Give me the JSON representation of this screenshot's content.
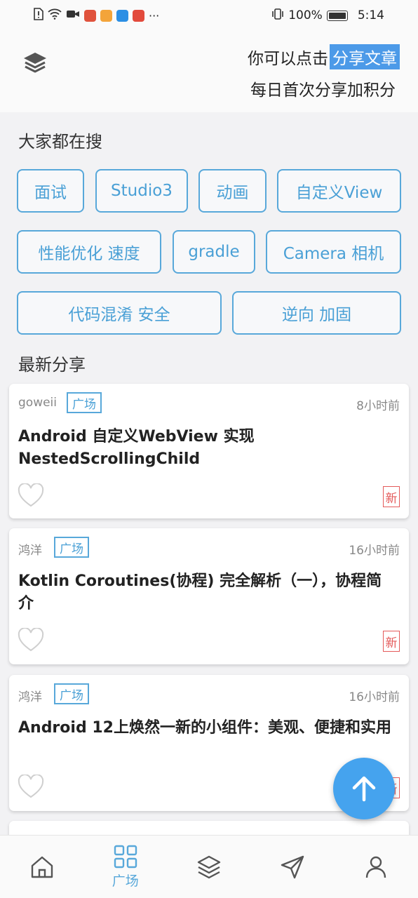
{
  "status_bar": {
    "battery": "100%",
    "time": "5:14",
    "more": "···"
  },
  "header": {
    "hint_prefix": "你可以点击",
    "share_link": "分享文章",
    "hint_line2": "每日首次分享加积分"
  },
  "search": {
    "title": "大家都在搜",
    "tags": [
      "面试",
      "Studio3",
      "动画",
      "自定义View",
      "性能优化 速度",
      "gradle",
      "Camera 相机",
      "代码混淆 安全",
      "逆向 加固"
    ]
  },
  "latest": {
    "title": "最新分享",
    "articles": [
      {
        "author": "goweii",
        "tag": "广场",
        "time": "8小时前",
        "title": "Android 自定义WebView 实现NestedScrollingChild",
        "badge": "新"
      },
      {
        "author": "鸿洋",
        "tag": "广场",
        "time": "16小时前",
        "title": "Kotlin Coroutines(协程) 完全解析（一），协程简介",
        "badge": "新"
      },
      {
        "author": "鸿洋",
        "tag": "广场",
        "time": "16小时前",
        "title": "Android 12上焕然一新的小组件：美观、便捷和实用",
        "badge": "新"
      }
    ]
  },
  "bottom_nav": {
    "items": [
      {
        "icon": "home-icon",
        "label": ""
      },
      {
        "icon": "grid-icon",
        "label": "广场"
      },
      {
        "icon": "layers-icon",
        "label": ""
      },
      {
        "icon": "navigation-icon",
        "label": ""
      },
      {
        "icon": "user-icon",
        "label": ""
      }
    ]
  },
  "colors": {
    "accent": "#4aa0d6",
    "fab": "#45a3ee",
    "new_badge": "#e45a5a",
    "highlight": "#4c9ae8"
  }
}
